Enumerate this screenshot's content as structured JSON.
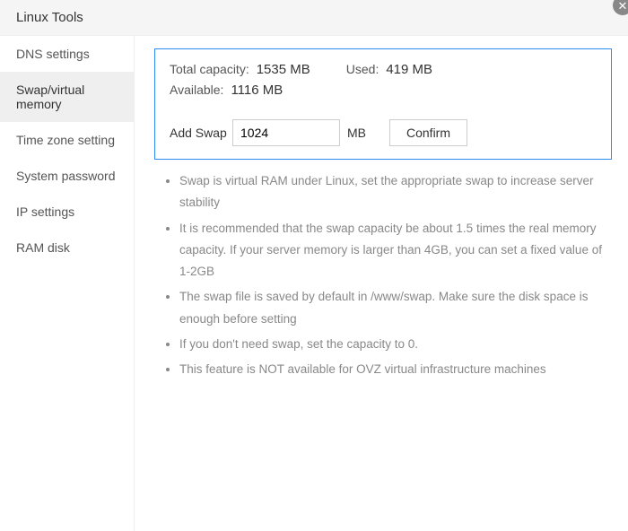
{
  "header": {
    "title": "Linux Tools"
  },
  "sidebar": {
    "items": [
      {
        "label": "DNS settings"
      },
      {
        "label": "Swap/virtual memory"
      },
      {
        "label": "Time zone setting"
      },
      {
        "label": "System password"
      },
      {
        "label": "IP settings"
      },
      {
        "label": "RAM disk"
      }
    ],
    "active_index": 1
  },
  "stats": {
    "total_label": "Total capacity:",
    "total_value": "1535 MB",
    "used_label": "Used:",
    "used_value": "419 MB",
    "available_label": "Available:",
    "available_value": "1116 MB"
  },
  "add_swap": {
    "label": "Add Swap",
    "value": "1024",
    "unit": "MB",
    "confirm": "Confirm"
  },
  "notes": [
    "Swap is virtual RAM under Linux, set the appropriate swap to increase server stability",
    "It is recommended that the swap capacity be about 1.5 times the real memory capacity. If your server memory is larger than 4GB, you can set a fixed value of 1-2GB",
    "The swap file is saved by default in /www/swap. Make sure the disk space is enough before setting",
    "If you don't need swap, set the capacity to 0.",
    "This feature is NOT available for OVZ virtual infrastructure machines"
  ]
}
